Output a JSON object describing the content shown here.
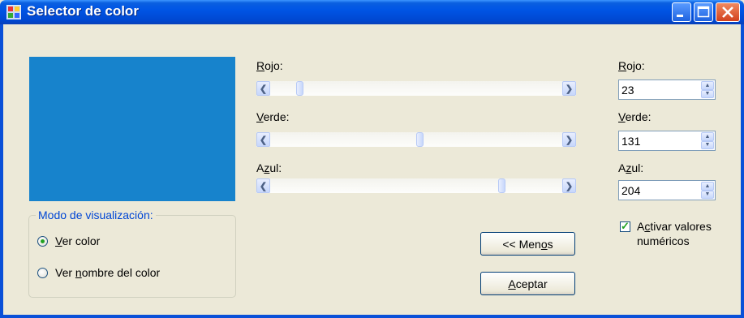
{
  "window": {
    "title": "Selector de color"
  },
  "preview": {
    "color": "#1783cc"
  },
  "display_mode": {
    "legend": "Modo de visualización:",
    "options": [
      {
        "label_prefix": "",
        "label_key": "V",
        "label_rest": "er color",
        "selected": true
      },
      {
        "label_prefix": "Ver ",
        "label_key": "n",
        "label_rest": "ombre del color",
        "selected": false
      }
    ]
  },
  "sliders": {
    "red": {
      "label_key": "R",
      "label_rest": "ojo:",
      "value": 23,
      "max": 255
    },
    "green": {
      "label_key": "V",
      "label_rest": "erde:",
      "value": 131,
      "max": 255
    },
    "blue": {
      "label_prefix": "A",
      "label_key": "z",
      "label_rest": "ul:",
      "value": 204,
      "max": 255
    }
  },
  "numeric": {
    "red": {
      "label_key": "R",
      "label_rest": "ojo:",
      "value": "23"
    },
    "green": {
      "label_key": "V",
      "label_rest": "erde:",
      "value": "131"
    },
    "blue": {
      "label_prefix": "A",
      "label_key": "z",
      "label_rest": "ul:",
      "value": "204"
    }
  },
  "numeric_toggle": {
    "line1_prefix": "A",
    "line1_key": "c",
    "line1_rest": "tivar valores",
    "line2": "numéricos",
    "checked": true
  },
  "buttons": {
    "less": {
      "prefix": "<< Men",
      "key": "o",
      "rest": "s"
    },
    "accept": {
      "key": "A",
      "rest": "ceptar"
    }
  },
  "icons": [
    "app-icon",
    "minimize-icon",
    "maximize-icon",
    "close-icon",
    "arrow-left-icon",
    "arrow-right-icon",
    "spin-up-icon",
    "spin-down-icon",
    "check-icon"
  ]
}
